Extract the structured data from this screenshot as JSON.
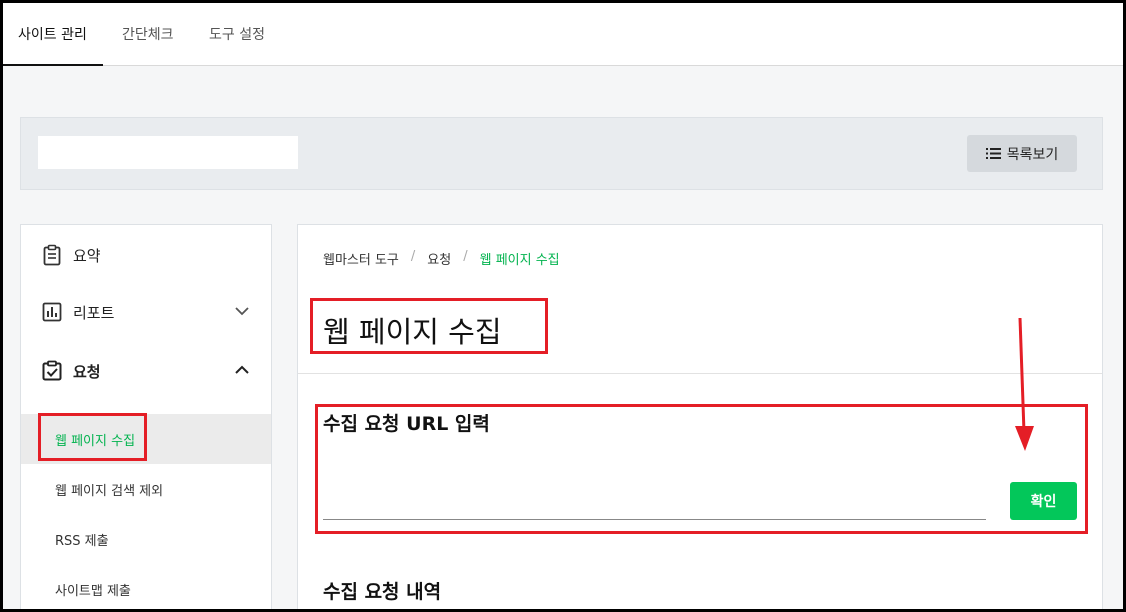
{
  "topnav": {
    "tabs": [
      {
        "label": "사이트 관리"
      },
      {
        "label": "간단체크"
      },
      {
        "label": "도구 설정"
      }
    ]
  },
  "site_bar": {
    "site_value": "",
    "list_button": "목록보기"
  },
  "sidebar": {
    "items": [
      {
        "label": "요약",
        "icon": "clipboard-icon"
      },
      {
        "label": "리포트",
        "icon": "chart-icon"
      },
      {
        "label": "요청",
        "icon": "clipboard-check-icon"
      }
    ],
    "sub_items": [
      {
        "label": "웹 페이지 수집"
      },
      {
        "label": "웹 페이지 검색 제외"
      },
      {
        "label": "RSS 제출"
      },
      {
        "label": "사이트맵 제출"
      }
    ]
  },
  "content": {
    "breadcrumb": [
      "웹마스터 도구",
      "요청",
      "웹 페이지 수집"
    ],
    "title": "웹 페이지 수집",
    "url_section_title": "수집 요청 URL 입력",
    "url_value": "",
    "confirm_button": "확인",
    "history_section_title": "수집 요청 내역"
  },
  "colors": {
    "accent": "#03c75a",
    "annotation": "#e41e26"
  }
}
